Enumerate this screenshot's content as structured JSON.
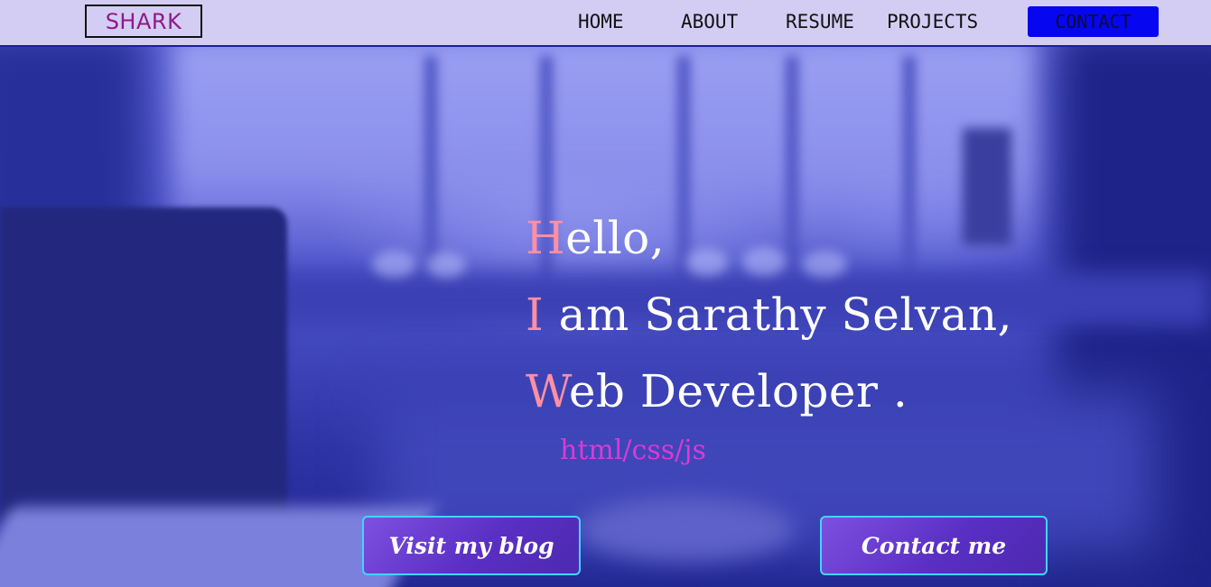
{
  "navbar": {
    "brand": "SHARK",
    "links": [
      "HOME",
      "ABOUT",
      "RESUME",
      "PROJECTS"
    ],
    "contact_label": "CONTACT"
  },
  "hero": {
    "greeting": "Hello,",
    "intro": "I am Sarathy Selvan,",
    "role": "Web Developer .",
    "tech": "html/css/js"
  },
  "actions": {
    "blog_label": "Visit my blog",
    "contact_label": "Contact me"
  },
  "colors": {
    "navbar_bg": "#d4cdf3",
    "brand_text": "#8d1a8a",
    "contact_button": "#0606f0",
    "first_letter_accent": "#ff8fa3",
    "tech_text": "#d83bd4",
    "cta_border": "#3fd6ff",
    "cta_fill": "#5a2fc4"
  }
}
